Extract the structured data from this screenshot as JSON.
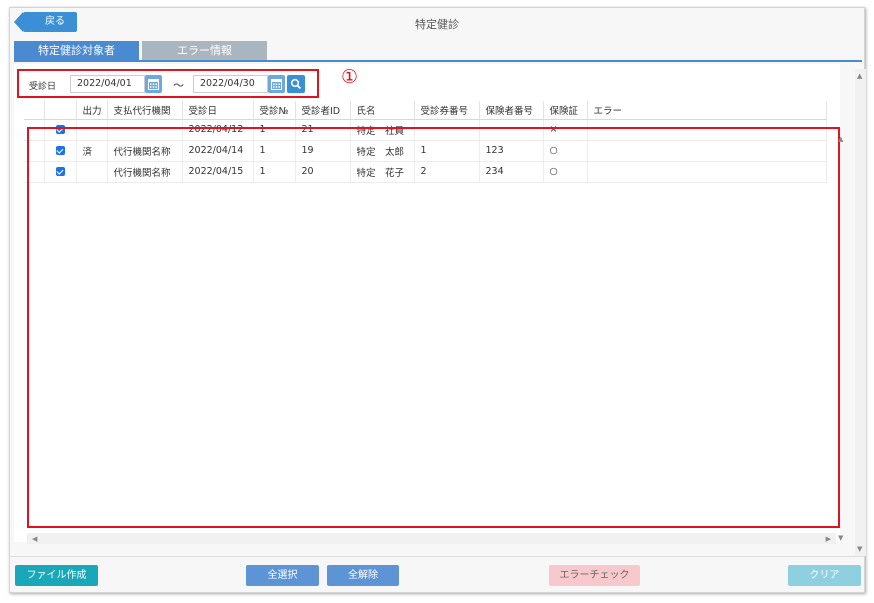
{
  "header": {
    "back_label": "戻る",
    "title": "特定健診"
  },
  "tabs": [
    {
      "label": "特定健診対象者",
      "active": true
    },
    {
      "label": "エラー情報",
      "active": false
    }
  ],
  "search": {
    "label": "受診日",
    "date_from": "2022/04/01",
    "separator": "～",
    "date_to": "2022/04/30"
  },
  "annotation": "①",
  "table": {
    "columns": [
      "",
      "",
      "出力",
      "支払代行機関",
      "受診日",
      "受診№",
      "受診者ID",
      "氏名",
      "受診券番号",
      "保険者番号",
      "保険証",
      "エラー"
    ],
    "rows": [
      {
        "checked": true,
        "output": "",
        "agency": "",
        "date": "2022/04/12",
        "no": "1",
        "id": "21",
        "name": "特定　社員",
        "ticket": "",
        "insurer": "",
        "card": "×",
        "error": ""
      },
      {
        "checked": true,
        "output": "済",
        "agency": "代行機関名称",
        "date": "2022/04/14",
        "no": "1",
        "id": "19",
        "name": "特定　太郎",
        "ticket": "1",
        "insurer": "123",
        "card": "○",
        "error": ""
      },
      {
        "checked": true,
        "output": "",
        "agency": "代行機関名称",
        "date": "2022/04/15",
        "no": "1",
        "id": "20",
        "name": "特定　花子",
        "ticket": "2",
        "insurer": "234",
        "card": "○",
        "error": ""
      }
    ]
  },
  "footer": {
    "file_button": "ファイル作成",
    "select_all": "全選択",
    "unselect_all": "全解除",
    "error_check": "エラーチェック",
    "clear": "クリア"
  },
  "colors": {
    "primary": "#3b8fd4",
    "highlight": "#e0141e",
    "teal": "#1aa7b8"
  }
}
